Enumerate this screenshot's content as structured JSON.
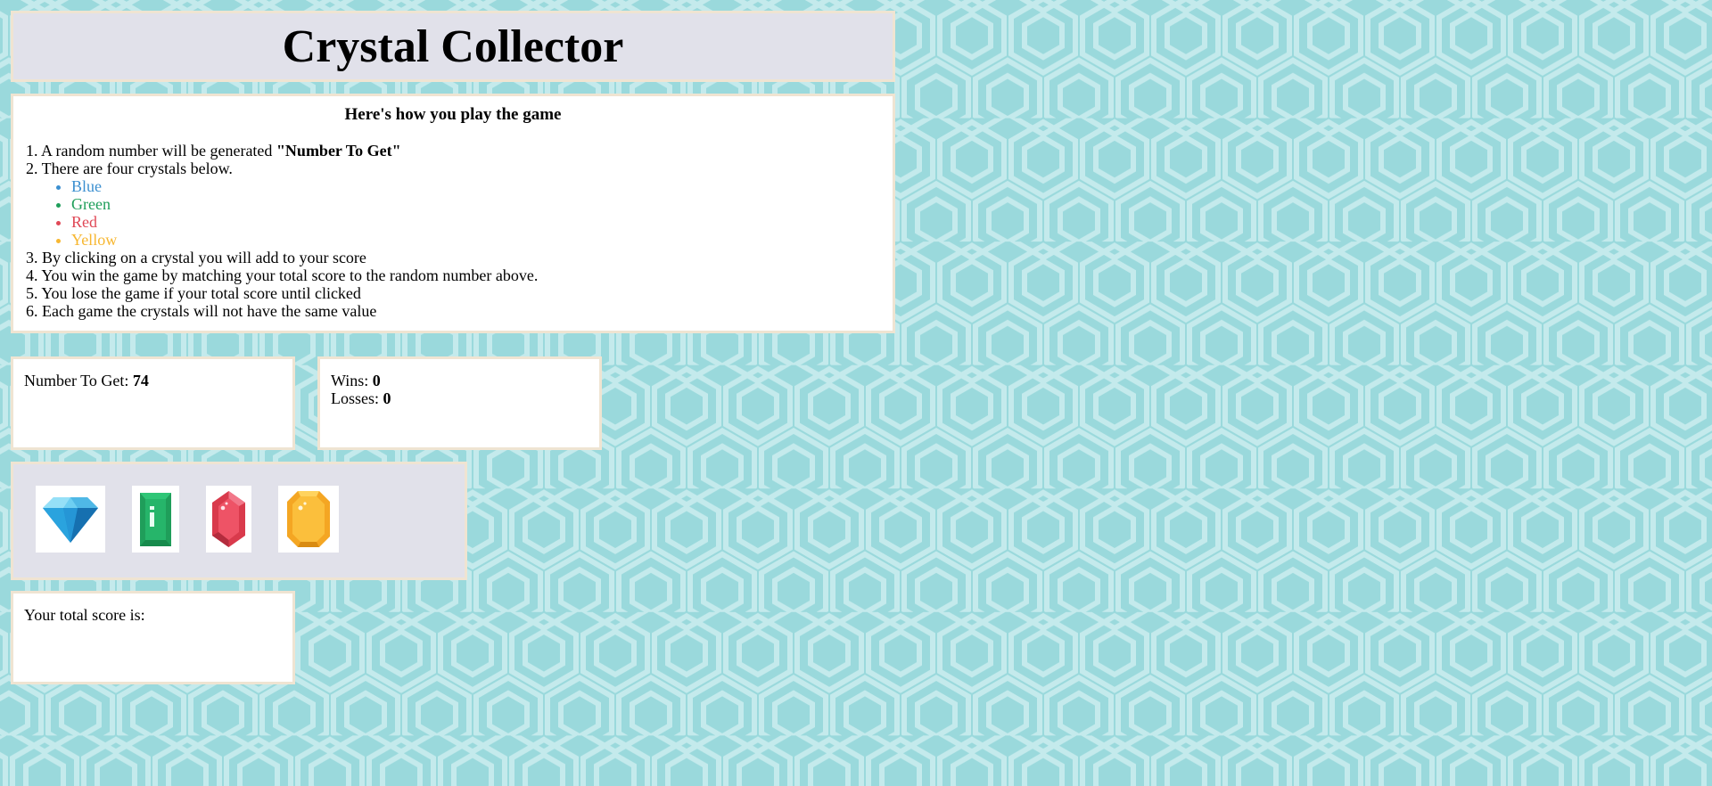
{
  "title": "Crystal Collector",
  "instructions": {
    "heading": "Here's how you play the game",
    "step1_text": "1. A random number will be generated ",
    "step1_bold": "\"Number To Get\"",
    "step2": "2. There are four crystals below.",
    "crystal_colors": [
      {
        "label": "Blue",
        "color": "#3b8fd0"
      },
      {
        "label": "Green",
        "color": "#1f9e5a"
      },
      {
        "label": "Red",
        "color": "#e04856"
      },
      {
        "label": "Yellow",
        "color": "#f7b731"
      }
    ],
    "step3": "3. By clicking on a crystal you will add to your score",
    "step4": "4. You win the game by matching your total score to the random number above.",
    "step5": "5. You lose the game if your total score until clicked",
    "step6": "6. Each game the crystals will not have the same value"
  },
  "target": {
    "label": "Number To Get: ",
    "value": "74"
  },
  "record": {
    "wins_label": "Wins: ",
    "wins_value": "0",
    "losses_label": "Losses: ",
    "losses_value": "0"
  },
  "crystals": [
    {
      "name": "blue-crystal",
      "icon": "diamond-icon"
    },
    {
      "name": "green-crystal",
      "icon": "emerald-icon"
    },
    {
      "name": "red-crystal",
      "icon": "ruby-icon"
    },
    {
      "name": "yellow-crystal",
      "icon": "topaz-icon"
    }
  ],
  "score": {
    "label": "Your total score is:",
    "value": ""
  },
  "colors": {
    "background": "#9ad9dc",
    "pattern": "#c4eaec",
    "panel_gray": "#e1e1ea",
    "panel_border": "#efe4d2"
  }
}
